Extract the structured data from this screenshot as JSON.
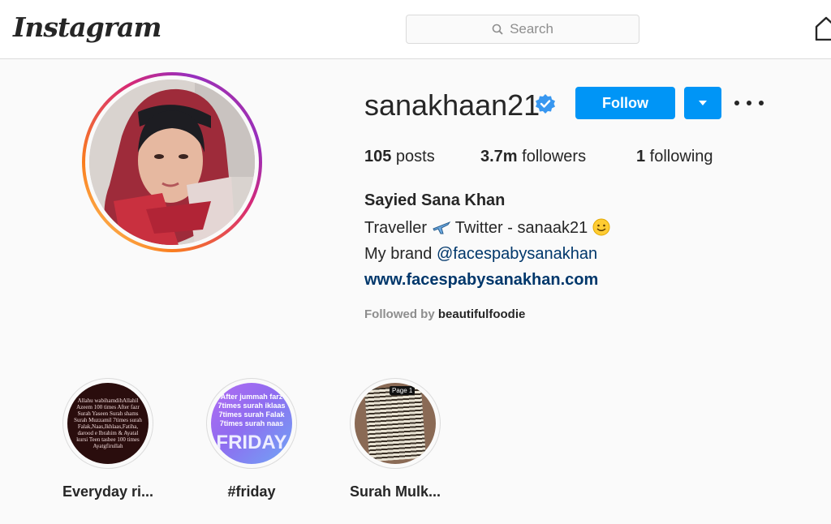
{
  "header": {
    "logo": "Instagram",
    "search_placeholder": "Search"
  },
  "profile": {
    "username": "sanakhaan21",
    "follow_label": "Follow",
    "stats": {
      "posts_count": "105",
      "posts_label": " posts",
      "followers_count": "3.7m",
      "followers_label": " followers",
      "following_count": "1",
      "following_label": " following"
    },
    "full_name": "Sayied Sana Khan",
    "bio": {
      "line1_a": "Traveller ",
      "line1_b": " Twitter - sanaak21 ",
      "line2_prefix": "My brand ",
      "line2_mention": "@facespabysanakhan",
      "website": "www.facespabysanakhan.com"
    },
    "followed_by_prefix": "Followed by ",
    "followed_by_user": "beautifulfoodie"
  },
  "highlights": [
    {
      "label": "Everyday ri...",
      "cover_text": "Allahu wabihamdihAllahil Azeem 100 times After fazr Surah Yaseen Surah shams Surah Muzzamil 7times surah Falak,Naas,Ikhlaas,Fatiha, darood e Ibrahim & Ayatal kursi Teen tasbee 100 times Ayatgfirullah"
    },
    {
      "label": "#friday",
      "cover_line1": "After jummah farz",
      "cover_line2": "7times surah iklaas",
      "cover_line3": "7times surah Falak",
      "cover_line4": "7times surah naas",
      "cover_big": "FRIDAY"
    },
    {
      "label": "Surah Mulk...",
      "cover_tag": "Page 1"
    }
  ],
  "colors": {
    "accent": "#0095f6",
    "link": "#00376b",
    "verified": "#3897f0"
  }
}
